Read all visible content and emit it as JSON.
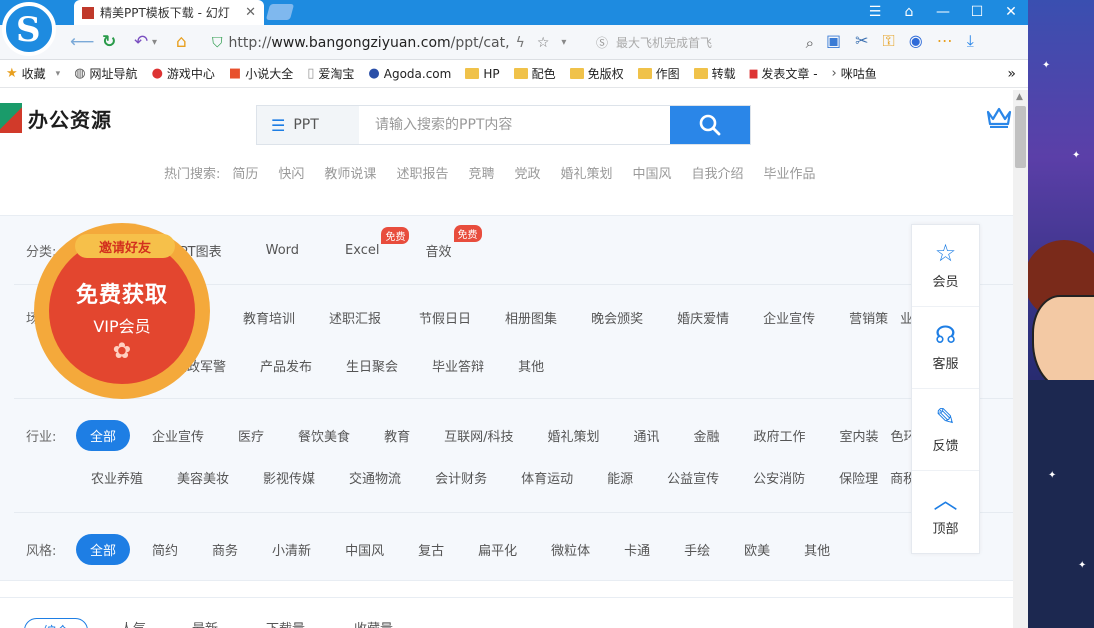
{
  "browser": {
    "logo_letter": "S",
    "tab_title": "精美PPT模板下载 - 幻灯",
    "tab_close": "✕",
    "window_controls": [
      "☰",
      "⌂",
      "—",
      "☐",
      "✕"
    ],
    "url_prefix": "http://",
    "url_host": "www.bangongziyuan.com",
    "url_path": "/ppt/cat,",
    "search_hint": "最大飞机完成首飞",
    "bookmarks": [
      {
        "label": "收藏",
        "icon": "star-icon"
      },
      {
        "label": "网址导航",
        "icon": "globe-icon"
      },
      {
        "label": "游戏中心",
        "icon": "game-icon"
      },
      {
        "label": "小说大全",
        "icon": "book-icon"
      },
      {
        "label": "爱淘宝",
        "icon": "page-icon"
      },
      {
        "label": "Agoda.com",
        "icon": "agoda-icon"
      },
      {
        "label": "HP",
        "icon": "folder-icon"
      },
      {
        "label": "配色",
        "icon": "folder-icon"
      },
      {
        "label": "免版权",
        "icon": "folder-icon"
      },
      {
        "label": "作图",
        "icon": "folder-icon"
      },
      {
        "label": "转载",
        "icon": "folder-icon"
      },
      {
        "label": "发表文章 -",
        "icon": "news-icon"
      },
      {
        "label": "咪咕鱼",
        "icon": "arrow-icon"
      }
    ],
    "bookmarks_more": "»"
  },
  "site": {
    "logo_text": "办公资源",
    "search_type": "PPT",
    "search_placeholder": "请输入搜索的PPT内容",
    "hot_label": "热门搜索:",
    "hot_keywords": [
      "简历",
      "快闪",
      "教师说课",
      "述职报告",
      "竞聘",
      "党政",
      "婚礼策划",
      "中国风",
      "自我介绍",
      "毕业作品"
    ]
  },
  "filters": {
    "category_label": "分类:",
    "categories": [
      {
        "label": "PPT图表",
        "tag": ""
      },
      {
        "label": "Word",
        "tag": ""
      },
      {
        "label": "Excel",
        "tag": "免费"
      },
      {
        "label": "音效",
        "tag": "免费"
      }
    ],
    "scene_label": "场",
    "scenes_row1": [
      "教育培训",
      "述职汇报",
      "节假日日",
      "相册图集",
      "晚会颁奖",
      "婚庆爱情",
      "企业宣传",
      "营销策",
      "业计划"
    ],
    "scenes_row2": [
      "党政军警",
      "产品发布",
      "生日聚会",
      "毕业答辩",
      "其他"
    ],
    "industry_label": "行业:",
    "industry_active": "全部",
    "industries_row1": [
      "企业宣传",
      "医疗",
      "餐饮美食",
      "教育",
      "互联网/科技",
      "婚礼策划",
      "通讯",
      "金融",
      "政府工作",
      "室内装",
      "色环保"
    ],
    "industries_row2": [
      "农业养殖",
      "美容美妆",
      "影视传媒",
      "交通物流",
      "会计财务",
      "体育运动",
      "能源",
      "公益宣传",
      "公安消防",
      "保险理",
      "商税务"
    ],
    "style_label": "风格:",
    "style_active": "全部",
    "styles": [
      "简约",
      "商务",
      "小清新",
      "中国风",
      "复古",
      "扁平化",
      "微粒体",
      "卡通",
      "手绘",
      "欧美",
      "其他"
    ]
  },
  "sort": [
    "综合",
    "人气",
    "最新",
    "下载量",
    "收藏量"
  ],
  "promo": {
    "ribbon": "邀请好友",
    "headline": "免费获取",
    "subline": "VIP会员"
  },
  "sidebar": [
    {
      "label": "会员",
      "icon": "vip-icon",
      "glyph": "☆"
    },
    {
      "label": "客服",
      "icon": "headset-icon",
      "glyph": "☊"
    },
    {
      "label": "反馈",
      "icon": "feedback-icon",
      "glyph": "✎"
    },
    {
      "label": "顶部",
      "icon": "top-arrow-icon",
      "glyph": "︿"
    }
  ]
}
